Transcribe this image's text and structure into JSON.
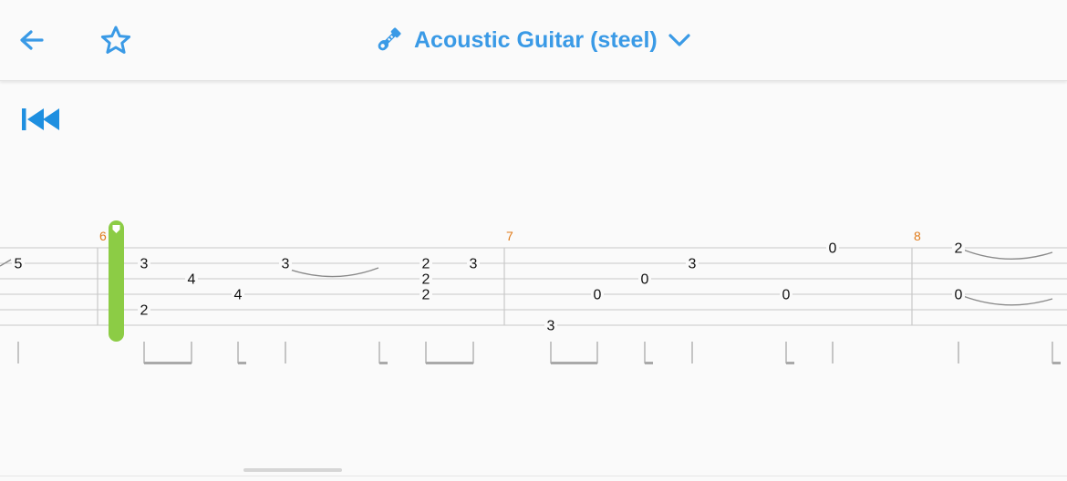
{
  "header": {
    "back_icon": "arrow-left-icon",
    "favorite_icon": "star-outline-icon",
    "instrument_icon": "guitar-icon",
    "instrument_label": "Acoustic Guitar (steel)",
    "dropdown_icon": "chevron-down-icon"
  },
  "player": {
    "rewind_icon": "skip-to-start-icon",
    "cursor_color": "#8ccc45"
  },
  "colors": {
    "accent": "#3a9ae6",
    "measure_number": "#e07b1a",
    "staff_lines": "#c8c8c8",
    "notes": "#111111"
  },
  "tablature": {
    "strings": 6,
    "measures": [
      {
        "number": "6"
      },
      {
        "number": "7"
      },
      {
        "number": "8"
      }
    ],
    "notes": [
      {
        "fret": "5",
        "string": 2,
        "beat": "m5-end"
      },
      {
        "fret": "3",
        "string": 2,
        "beat": "m6-1"
      },
      {
        "fret": "2",
        "string": 5,
        "beat": "m6-1"
      },
      {
        "fret": "4",
        "string": 4,
        "beat": "m6-2"
      },
      {
        "fret": "4",
        "string": 3,
        "beat": "m6-3"
      },
      {
        "fret": "3",
        "string": 2,
        "beat": "m6-4"
      },
      {
        "fret": "2",
        "string": 2,
        "beat": "m6-5"
      },
      {
        "fret": "2",
        "string": 3,
        "beat": "m6-5"
      },
      {
        "fret": "2",
        "string": 4,
        "beat": "m6-5"
      },
      {
        "fret": "3",
        "string": 2,
        "beat": "m6-6"
      },
      {
        "fret": "3",
        "string": 6,
        "beat": "m7-1"
      },
      {
        "fret": "0",
        "string": 4,
        "beat": "m7-2"
      },
      {
        "fret": "0",
        "string": 3,
        "beat": "m7-3"
      },
      {
        "fret": "3",
        "string": 2,
        "beat": "m7-4"
      },
      {
        "fret": "0",
        "string": 4,
        "beat": "m7-5"
      },
      {
        "fret": "0",
        "string": 1,
        "beat": "m7-6"
      },
      {
        "fret": "2",
        "string": 1,
        "beat": "m8-1"
      },
      {
        "fret": "0",
        "string": 4,
        "beat": "m8-1"
      }
    ]
  }
}
